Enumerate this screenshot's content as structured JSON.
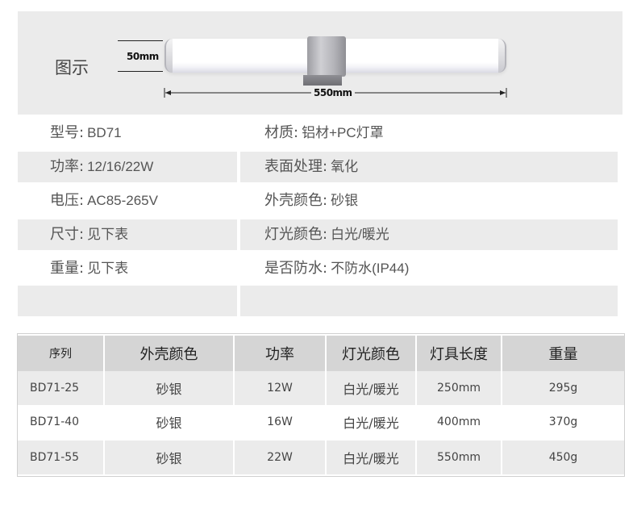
{
  "illustration": {
    "label": "图示",
    "height_dim": "50mm",
    "width_dim": "550mm"
  },
  "specs": [
    {
      "left_label": "型号:",
      "left_value": "BD71",
      "right_label": "材质:",
      "right_value": "铝材+PC灯罩"
    },
    {
      "left_label": "功率:",
      "left_value": "12/16/22W",
      "right_label": "表面处理:",
      "right_value": "氧化"
    },
    {
      "left_label": "电压:",
      "left_value": "AC85-265V",
      "right_label": "外壳颜色:",
      "right_value": "砂银"
    },
    {
      "left_label": "尺寸:",
      "left_value": "见下表",
      "right_label": "灯光颜色:",
      "right_value": "白光/暖光"
    },
    {
      "left_label": "重量:",
      "left_value": "见下表",
      "right_label": "是否防水:",
      "right_value": "不防水(IP44)"
    },
    {
      "left_label": "",
      "left_value": "",
      "right_label": "",
      "right_value": ""
    }
  ],
  "size_table": {
    "headers": [
      "序列",
      "外壳颜色",
      "功率",
      "灯光颜色",
      "灯具长度",
      "重量"
    ],
    "rows": [
      [
        "BD71-25",
        "砂银",
        "12W",
        "白光/暖光",
        "250mm",
        "295g"
      ],
      [
        "BD71-40",
        "砂银",
        "16W",
        "白光/暖光",
        "400mm",
        "370g"
      ],
      [
        "BD71-55",
        "砂银",
        "22W",
        "白光/暖光",
        "550mm",
        "450g"
      ]
    ]
  }
}
